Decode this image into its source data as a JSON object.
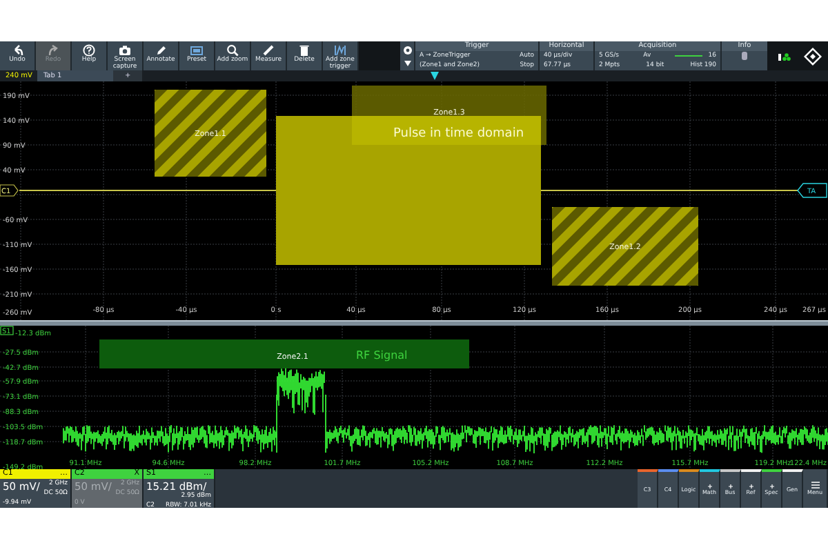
{
  "toolbar": {
    "buttons": [
      {
        "label": "Undo",
        "disabled": false
      },
      {
        "label": "Redo",
        "disabled": true
      },
      {
        "label": "Help",
        "disabled": false
      },
      {
        "label": "Screen capture",
        "disabled": false
      },
      {
        "label": "Annotate",
        "disabled": false
      },
      {
        "label": "Preset",
        "disabled": false
      },
      {
        "label": "Add zoom",
        "disabled": false
      },
      {
        "label": "Measure",
        "disabled": false
      },
      {
        "label": "Delete",
        "disabled": false
      },
      {
        "label": "Add zone trigger",
        "disabled": false
      }
    ]
  },
  "trigger": {
    "title": "Trigger",
    "source": "A → ZoneTrigger",
    "mode": "Auto",
    "condition": "(Zone1 and Zone2)",
    "state": "Stop"
  },
  "horizontal": {
    "title": "Horizontal",
    "scale": "40 µs/div",
    "position": "67.77 µs"
  },
  "acquisition": {
    "title": "Acquisition",
    "rate": "5 GS/s",
    "mode": "Av",
    "count": "16",
    "points": "2 Mpts",
    "resolution": "14 bit",
    "history": "Hist 190",
    "level": 1
  },
  "info": {
    "title": "Info"
  },
  "tab_strip": {
    "scale": "240 mV",
    "tabs": [
      {
        "label": "Tab 1",
        "selected": true
      }
    ],
    "add": "+"
  },
  "time_plot": {
    "channel_marker": "C1",
    "trigger_marker": "TA",
    "y_labels": [
      "190 mV",
      "140 mV",
      "90 mV",
      "40 mV",
      "-60 mV",
      "-110 mV",
      "-160 mV",
      "-210 mV",
      "-260 mV"
    ],
    "x_labels": [
      "-80 µs",
      "-40 µs",
      "0 s",
      "40 µs",
      "80 µs",
      "120 µs",
      "160 µs",
      "200 µs",
      "240 µs",
      "267 µs"
    ],
    "zones": [
      {
        "label": "Zone1.1",
        "kind": "hatched"
      },
      {
        "label": "Zone1.3",
        "kind": "solid"
      },
      {
        "label": "Zone1.2",
        "kind": "hatched"
      }
    ],
    "annotation": "Pulse in time domain"
  },
  "spectrum_plot": {
    "marker": "S1",
    "y_labels": [
      "-12.3 dBm",
      "-27.5 dBm",
      "-42.7 dBm",
      "-57.9 dBm",
      "-73.1 dBm",
      "-88.3 dBm",
      "-103.5 dBm",
      "-118.7 dBm",
      "-149.2 dBm"
    ],
    "x_labels": [
      "91.1 MHz",
      "94.6 MHz",
      "98.2 MHz",
      "101.7 MHz",
      "105.2 MHz",
      "108.7 MHz",
      "112.2 MHz",
      "115.7 MHz",
      "119.2 MHz",
      "122.4 MHz"
    ],
    "zones": [
      {
        "label": "Zone2.1",
        "kind": "solid"
      }
    ],
    "annotation": "RF Signal"
  },
  "channels": [
    {
      "name": "C1",
      "color": "#f0f000",
      "active": true,
      "scale": "50 mV/",
      "bandwidth": "2 GHz",
      "coupling": "DC 50Ω",
      "offset": "-9.94 mV",
      "close": "…"
    },
    {
      "name": "C2",
      "color": "#3fd23f",
      "active": false,
      "scale": "50 mV/",
      "bandwidth": "2 GHz",
      "coupling": "DC 50Ω",
      "offset": "0 V",
      "close": "X"
    },
    {
      "name": "S1",
      "color": "#3fd23f",
      "active": true,
      "scale": "15.21 dBm/",
      "bandwidth": "2.95 dBm",
      "offset": "C2",
      "extra": "RBW: 7.01 kHz",
      "close": "…"
    }
  ],
  "source_buttons": [
    {
      "label": "C3",
      "color": "#e8642c",
      "plus": false
    },
    {
      "label": "C4",
      "color": "#5b8def",
      "plus": false
    },
    {
      "label": "Logic",
      "color": "#d98a1e",
      "plus": false
    },
    {
      "label": "Math",
      "color": "#22c8e0",
      "plus": true
    },
    {
      "label": "Bus",
      "color": "#c8c8c8",
      "plus": true
    },
    {
      "label": "Ref",
      "color": "#f0f0f0",
      "plus": true
    },
    {
      "label": "Spec",
      "color": "#3fd23f",
      "plus": true
    },
    {
      "label": "Gen",
      "color": "#f0f0f0",
      "plus": false
    }
  ],
  "menu": {
    "label": "Menu"
  }
}
